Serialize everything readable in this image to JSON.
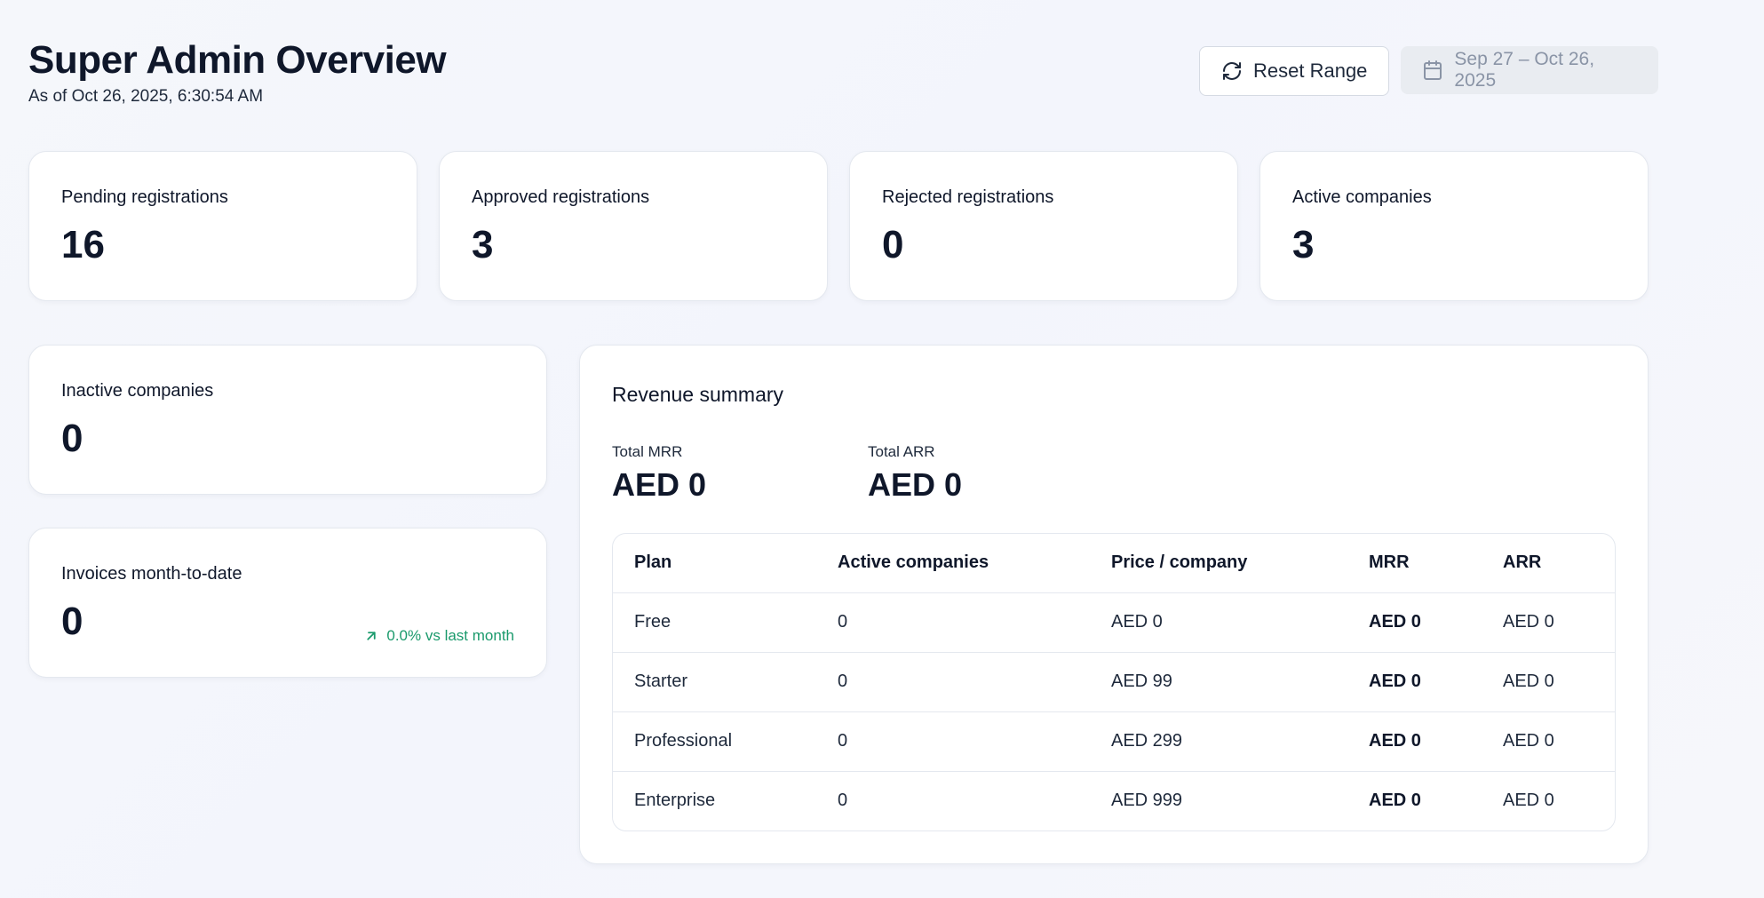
{
  "header": {
    "title": "Super Admin Overview",
    "subtitle": "As of Oct 26, 2025, 6:30:54 AM",
    "reset_label": "Reset Range",
    "date_range": "Sep 27 – Oct 26, 2025"
  },
  "stats": [
    {
      "label": "Pending registrations",
      "value": "16"
    },
    {
      "label": "Approved registrations",
      "value": "3"
    },
    {
      "label": "Rejected registrations",
      "value": "0"
    },
    {
      "label": "Active companies",
      "value": "3"
    }
  ],
  "inactive": {
    "label": "Inactive companies",
    "value": "0"
  },
  "invoices": {
    "label": "Invoices month-to-date",
    "value": "0",
    "trend": "0.0% vs last month"
  },
  "revenue": {
    "title": "Revenue summary",
    "mrr_label": "Total MRR",
    "mrr_value": "AED 0",
    "arr_label": "Total ARR",
    "arr_value": "AED 0",
    "columns": [
      "Plan",
      "Active companies",
      "Price / company",
      "MRR",
      "ARR"
    ],
    "rows": [
      [
        "Free",
        "0",
        "AED 0",
        "AED 0",
        "AED 0"
      ],
      [
        "Starter",
        "0",
        "AED 99",
        "AED 0",
        "AED 0"
      ],
      [
        "Professional",
        "0",
        "AED 299",
        "AED 0",
        "AED 0"
      ],
      [
        "Enterprise",
        "0",
        "AED 999",
        "AED 0",
        "AED 0"
      ]
    ]
  },
  "colors": {
    "trend_positive": "#1a9a6c",
    "text_primary": "#0f172a",
    "date_range_bg": "#e9ecf1"
  },
  "icons": {
    "reset": "refresh-icon",
    "date": "calendar-icon",
    "trend": "arrow-up-right-icon"
  }
}
